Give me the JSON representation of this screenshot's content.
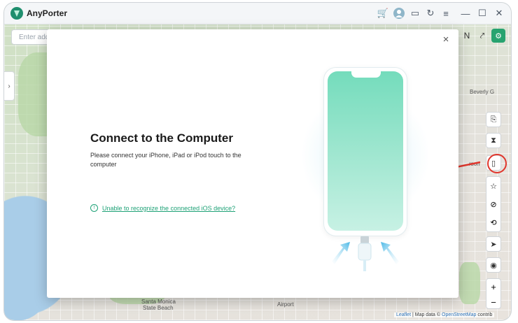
{
  "app": {
    "title": "AnyPorter"
  },
  "titlebar": {
    "icons": [
      "cart-icon",
      "user-avatar-icon",
      "chat-icon",
      "refresh-icon",
      "menu-icon",
      "minimize-icon",
      "maximize-icon",
      "close-icon"
    ],
    "glyphs": {
      "cart": "🛒",
      "user": "●",
      "chat": "▭",
      "refresh": "↻",
      "menu": "≡",
      "minimize": "—",
      "maximize": "☐",
      "close": "✕"
    }
  },
  "map": {
    "search_placeholder": "Enter add",
    "labels": {
      "beverly": "Beverly G",
      "watson": "rson",
      "santa_monica_1": "Santa Monica",
      "santa_monica_2": "State Beach",
      "airport": "Airport"
    },
    "attribution": {
      "leaflet": "Leaflet",
      "sep": "| Map data ©",
      "osm": "OpenStreetMap",
      "tail": "contrib"
    },
    "top_tools": {
      "n": "N",
      "route": "⤤",
      "settings": "⚙"
    }
  },
  "side_tools": {
    "export": "⎘",
    "timer": "⧗",
    "device": "▯",
    "favorite": "☆",
    "block": "⊘",
    "history": "⟲",
    "navigate": "➤",
    "locate": "◉",
    "zoom_in": "+",
    "zoom_out": "−"
  },
  "modal": {
    "close": "×",
    "heading": "Connect to the Computer",
    "description": "Please connect your iPhone, iPad or iPod touch to the computer",
    "help_icon": "!",
    "help_link": "Unable to recognize the connected iOS device?"
  },
  "colors": {
    "accent": "#1fa277",
    "annotation": "#e0362c",
    "phone_screen_top": "#74dcbc"
  }
}
